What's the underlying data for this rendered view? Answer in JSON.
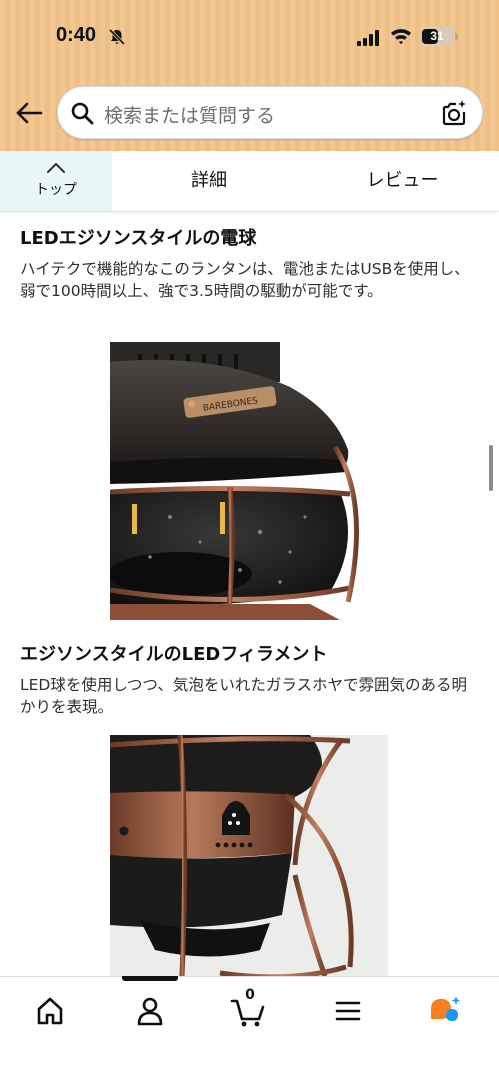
{
  "status_bar": {
    "time": "0:40",
    "battery": "31",
    "icons": [
      "bell-off-icon",
      "cellular-signal-icon",
      "wifi-icon",
      "battery-icon"
    ]
  },
  "search": {
    "placeholder": "検索または質問する",
    "icons": [
      "back-arrow-icon",
      "search-icon",
      "camera-icon"
    ]
  },
  "tabs": {
    "top_label": "トップ",
    "detail_label": "詳細",
    "review_label": "レビュー"
  },
  "sections": [
    {
      "title": "LEDエジソンスタイルの電球",
      "body": "ハイテクで機能的なこのランタンは、電池またはUSBを使用し、弱で100時間以上、強で3.5時間の駆動が可能です。"
    },
    {
      "title": "エジソンスタイルのLEDフィラメント",
      "body": "LED球を使用しつつ、気泡をいれたガラスホヤで雰囲気のある明かりを表現。"
    }
  ],
  "images": {
    "badge_text": "BAREBONES"
  },
  "bottom_nav": {
    "cart_count": "0",
    "icons": [
      "home-icon",
      "profile-icon",
      "cart-icon",
      "menu-icon",
      "rufus-icon"
    ]
  },
  "colors": {
    "header_bg": "#f2c792",
    "tab_active_bg": "#e8f7f5",
    "rufus_orange": "#f77f1f",
    "rufus_blue": "#1a98ff"
  }
}
